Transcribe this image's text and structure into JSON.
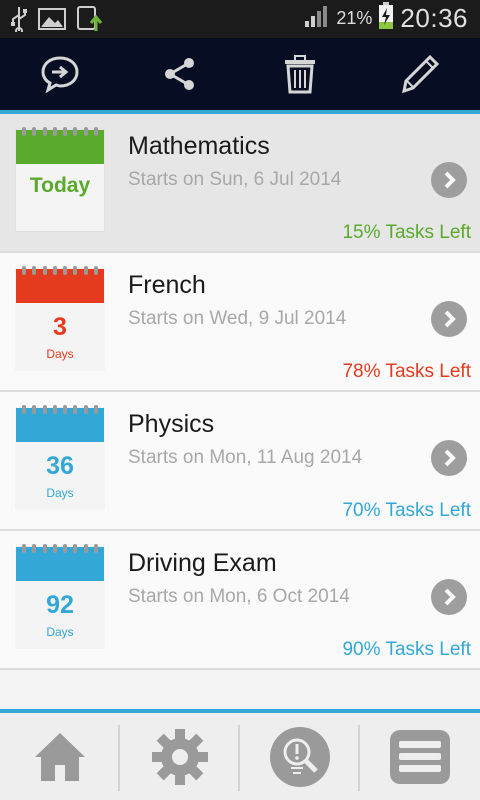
{
  "status_bar": {
    "icons": [
      "usb-icon",
      "gallery-icon",
      "download-icon"
    ],
    "signal": "signal-icon",
    "battery_percent": "21%",
    "battery_icon": "battery-charging-icon",
    "time": "20:36"
  },
  "action_bar": {
    "actions": [
      "chat-reply-icon",
      "share-icon",
      "trash-icon",
      "pencil-icon"
    ],
    "background": "#070d22",
    "accent": "#33a7d6"
  },
  "exams": [
    {
      "title": "Mathematics",
      "start": "Starts on Sun, 6 Jul 2014",
      "badge_main": "Today",
      "badge_sub": "",
      "tasks_left": "15% Tasks Left",
      "color": "#5aaa2c",
      "selected": true
    },
    {
      "title": "French",
      "start": "Starts on Wed, 9 Jul 2014",
      "badge_main": "3",
      "badge_sub": "Days",
      "tasks_left": "78% Tasks Left",
      "color": "#e43b1e",
      "selected": false
    },
    {
      "title": "Physics",
      "start": "Starts on Mon, 11 Aug 2014",
      "badge_main": "36",
      "badge_sub": "Days",
      "tasks_left": "70% Tasks Left",
      "color": "#33a7d6",
      "selected": false
    },
    {
      "title": "Driving Exam",
      "start": "Starts on Mon, 6 Oct 2014",
      "badge_main": "92",
      "badge_sub": "Days",
      "tasks_left": "90% Tasks Left",
      "color": "#33a7d6",
      "selected": false
    }
  ],
  "bottom_tabs": [
    "home-icon",
    "settings-gear-icon",
    "search-idea-icon",
    "menu-list-icon"
  ]
}
